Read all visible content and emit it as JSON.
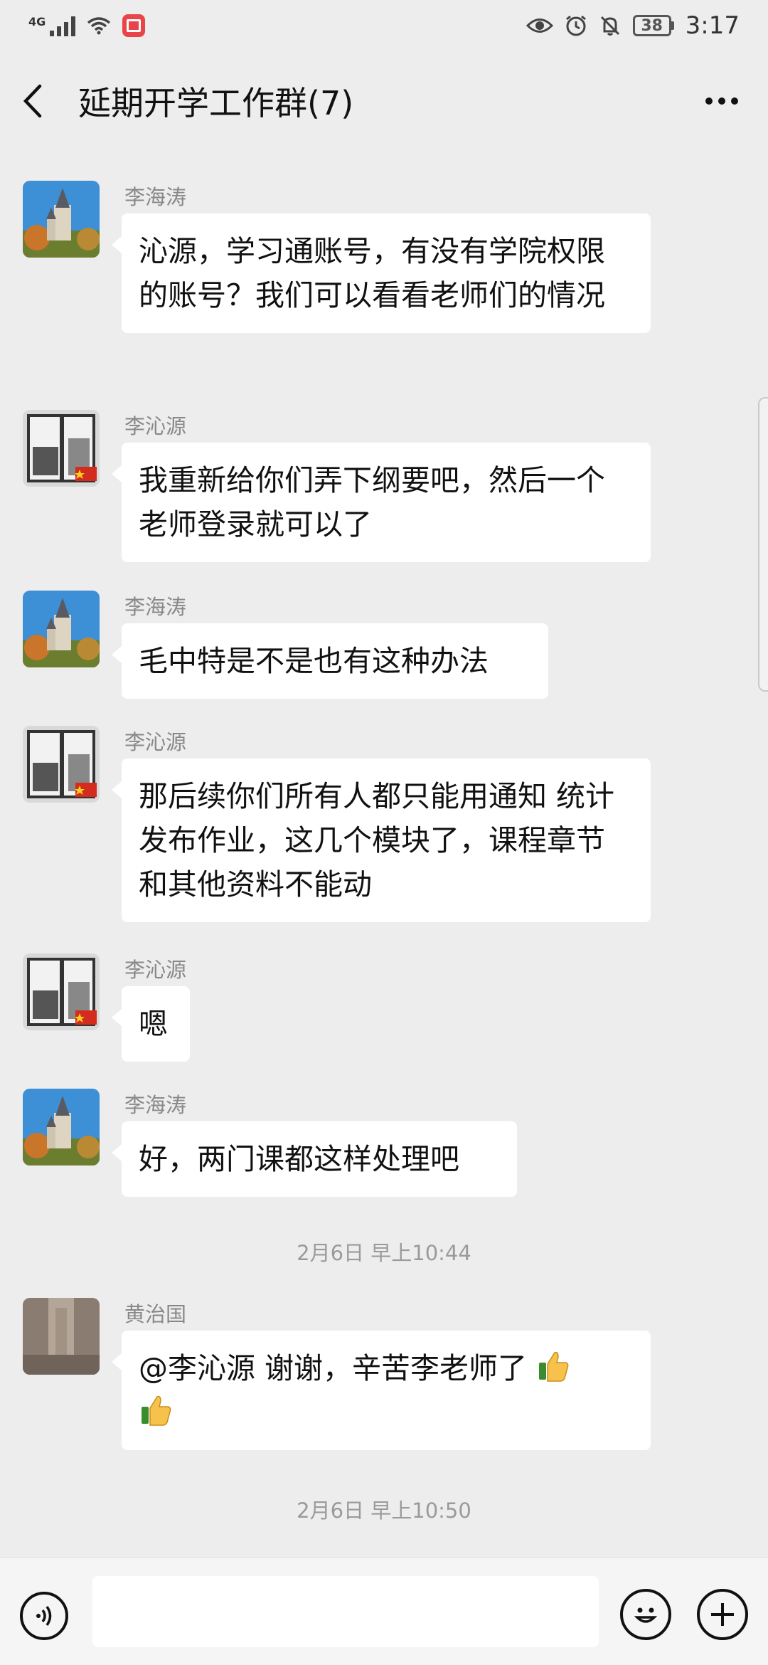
{
  "status_bar": {
    "network": "4G",
    "battery": "38",
    "time": "3:17"
  },
  "header": {
    "title": "延期开学工作群(7)"
  },
  "messages": [
    {
      "sender": "李海涛",
      "text": "沁源，学习通账号，有没有学院权限的账号？我们可以看看老师们的情况",
      "avatar": "castle-avatar"
    },
    {
      "sender": "李沁源",
      "text": "我重新给你们弄下纲要吧，然后一个老师登录就可以了",
      "avatar": "window-avatar"
    },
    {
      "sender": "李海涛",
      "text": "毛中特是不是也有这种办法",
      "avatar": "castle-avatar"
    },
    {
      "sender": "李沁源",
      "text": "那后续你们所有人都只能用通知 统计 发布作业，这几个模块了，课程章节和其他资料不能动",
      "avatar": "window-avatar"
    },
    {
      "sender": "李沁源",
      "text": "嗯",
      "avatar": "window-avatar"
    },
    {
      "sender": "李海涛",
      "text": "好，两门课都这样处理吧",
      "avatar": "castle-avatar"
    },
    {
      "sender": "黄治国",
      "text": "@李沁源  谢谢，辛苦李老师了",
      "avatar": "stone-avatar"
    }
  ],
  "timestamps": [
    "2月6日 早上10:44",
    "2月6日 早上10:50"
  ],
  "colors": {
    "background": "#EDEDED",
    "bubble": "#FFFFFF",
    "meta_text": "#888888"
  }
}
